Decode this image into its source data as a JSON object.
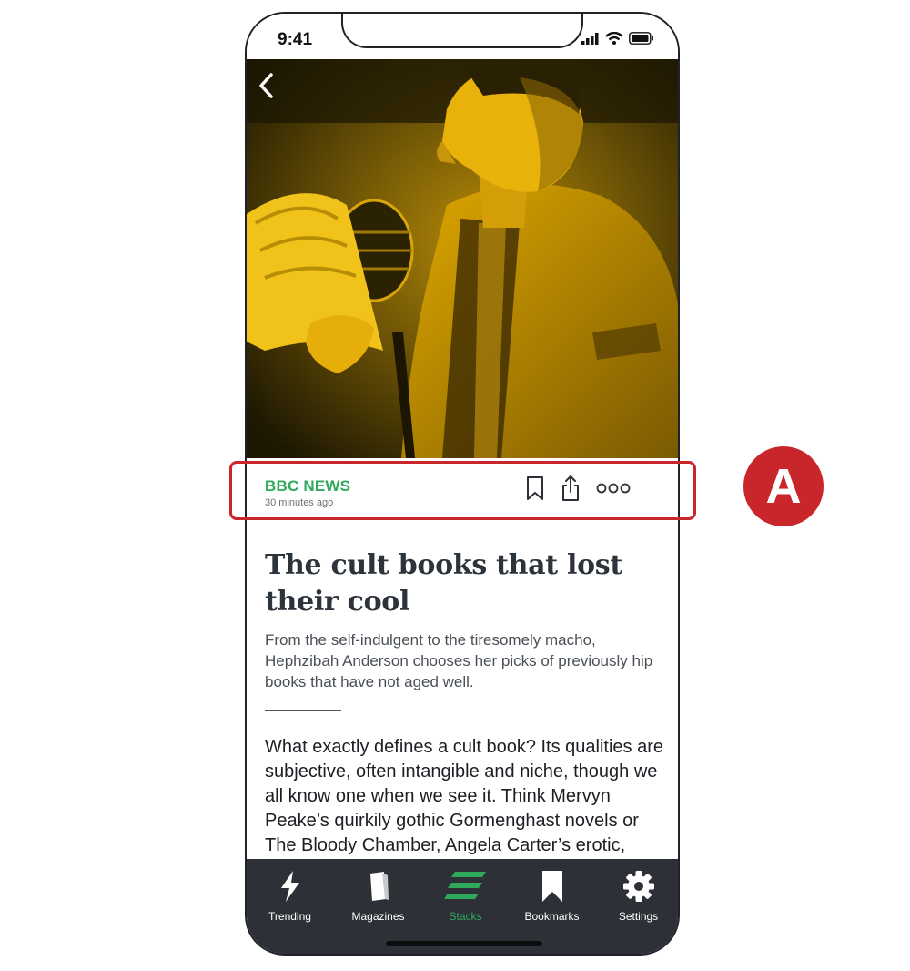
{
  "status_bar": {
    "time": "9:41",
    "icons": [
      "cellular-signal-icon",
      "wifi-icon",
      "battery-icon"
    ]
  },
  "hero": {
    "description_icon": "photo",
    "tint": "#e0a800"
  },
  "meta": {
    "source": "BBC NEWS",
    "timestamp": "30 minutes ago",
    "actions": [
      "bookmark-icon",
      "share-icon",
      "more-icon"
    ]
  },
  "article": {
    "headline": "The cult books that lost their cool",
    "dek": "From the self-indulgent to the tiresomely macho, Hephzibah Anderson chooses her picks of previously hip books that have not aged well.",
    "body": "What exactly defines a cult book? Its qualities are subjective, often intangible and niche, though we all know one when we see it. Think Mervyn Peake’s quirkily gothic Gormenghast novels or The Bloody Chamber, Angela Carter’s erotic, dreamlike"
  },
  "tab_bar": {
    "tabs": [
      {
        "label": "Trending",
        "icon": "lightning-icon"
      },
      {
        "label": "Magazines",
        "icon": "magazine-icon"
      },
      {
        "label": "Stacks",
        "icon": "stacks-icon",
        "active": true
      },
      {
        "label": "Bookmarks",
        "icon": "bookmark-icon"
      },
      {
        "label": "Settings",
        "icon": "gear-icon"
      }
    ]
  },
  "annotation": {
    "label": "A",
    "color": "#c9262b"
  },
  "colors": {
    "accent": "#2faa5c",
    "tab_bar": "#2d3137"
  }
}
